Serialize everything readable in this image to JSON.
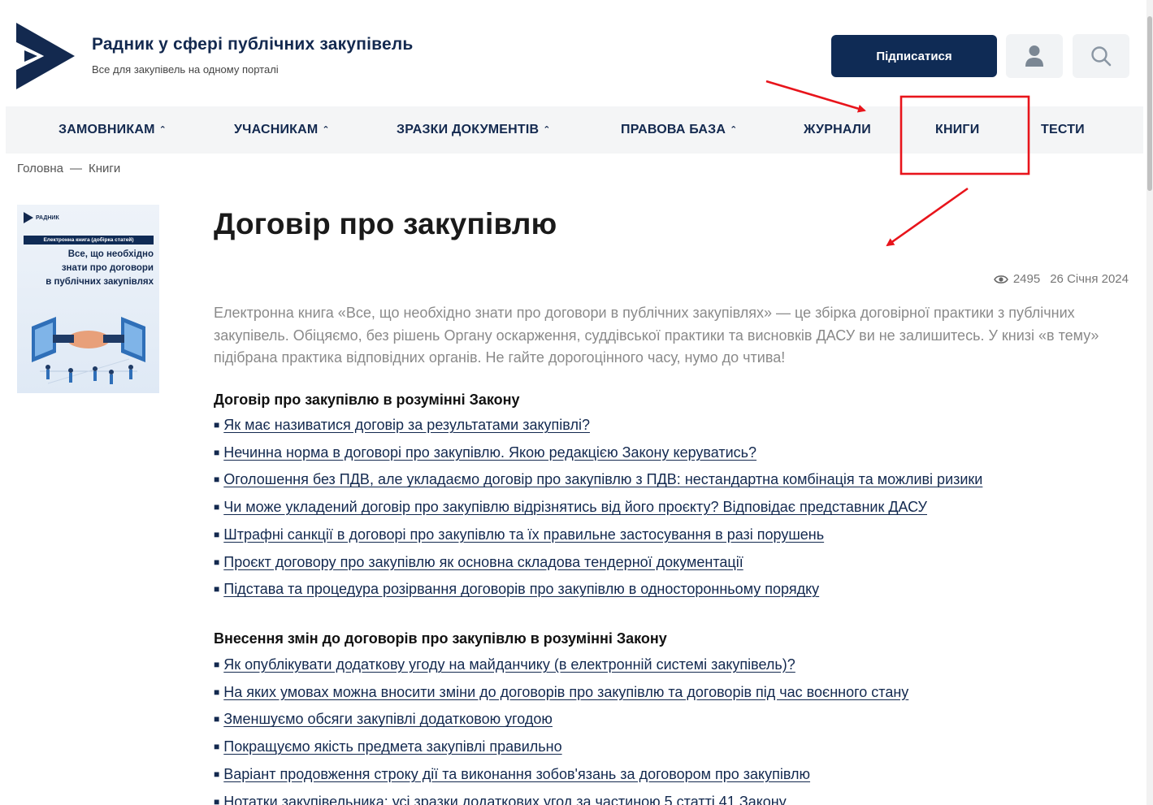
{
  "header": {
    "site_title": "Радник у сфері публічних закупівель",
    "tagline": "Все для закупівель на одному порталі",
    "subscribe_label": "Підписатися",
    "icons": [
      "logo-icon",
      "user-icon",
      "search-icon"
    ]
  },
  "nav": {
    "items": [
      {
        "label": "ЗАМОВНИКАМ",
        "has_dropdown": true
      },
      {
        "label": "УЧАСНИКАМ",
        "has_dropdown": true
      },
      {
        "label": "ЗРАЗКИ ДОКУМЕНТІВ",
        "has_dropdown": true
      },
      {
        "label": "ПРАВОВА БАЗА",
        "has_dropdown": true
      },
      {
        "label": "ЖУРНАЛИ",
        "has_dropdown": false
      },
      {
        "label": "КНИГИ",
        "has_dropdown": false
      },
      {
        "label": "ТЕСТИ",
        "has_dropdown": false
      }
    ],
    "caret": "⌃"
  },
  "breadcrumb": {
    "home": "Головна",
    "separator": "—",
    "current": "Книги"
  },
  "cover": {
    "brand": "РАДНИК",
    "band": "Електронна книга (добірка статей)",
    "title_lines": [
      "Все, що необхідно",
      "знати про договори",
      "в публічних закупівлях"
    ]
  },
  "article": {
    "title": "Договір про закупівлю",
    "views": "2495",
    "date": "26 Січня 2024",
    "intro": "Електронна книга «Все, що необхідно знати про договори в публічних закупівлях» — це збірка договірної практики з публічних закупівель. Обіцяємо, без рішень Органу оскарження, суддівської практики та висновків ДАСУ ви не залишитесь. У книзі «в тему» підібрана практика відповідних органів. Не гайте дорогоцінного часу, нумо до чтива!"
  },
  "sections": [
    {
      "heading": "Договір про закупівлю в розумінні Закону",
      "links": [
        "Як має називатися договір за результатами закупівлі?",
        "Нечинна норма в договорі про закупівлю. Якою редакцією Закону керуватись?",
        "Оголошення без ПДВ, але укладаємо договір про закупівлю з ПДВ: нестандартна комбінація та можливі ризики",
        "Чи може укладений договір про закупівлю відрізнятись від його проєкту? Відповідає представник ДАСУ",
        "Штрафні санкції в договорі про закупівлю та їх правильне застосування в разі порушень",
        "Проєкт договору про закупівлю як основна складова тендерної документації",
        "Підстава та процедура розірвання договорів про закупівлю в односторонньому порядку"
      ]
    },
    {
      "heading": "Внесення змін до договорів про закупівлю в розумінні Закону",
      "links": [
        "Як опублікувати додаткову угоду на майданчику (в електронній системі закупівель)?",
        "На яких умовах можна вносити зміни до договорів про закупівлю та договорів під час воєнного стану",
        "Зменшуємо обсяги закупівлі додатковою угодою",
        "Покращуємо якість предмета закупівлі правильно",
        "Варіант продовження строку дії та виконання зобов'язань за договором про закупівлю",
        "Нотатки закупівельника: усі зразки додаткових угод за частиною 5 статті 41 Закону"
      ]
    }
  ],
  "colors": {
    "brand_navy": "#13294f",
    "button_navy": "#0f2b55",
    "annotation_red": "#e8141b"
  }
}
